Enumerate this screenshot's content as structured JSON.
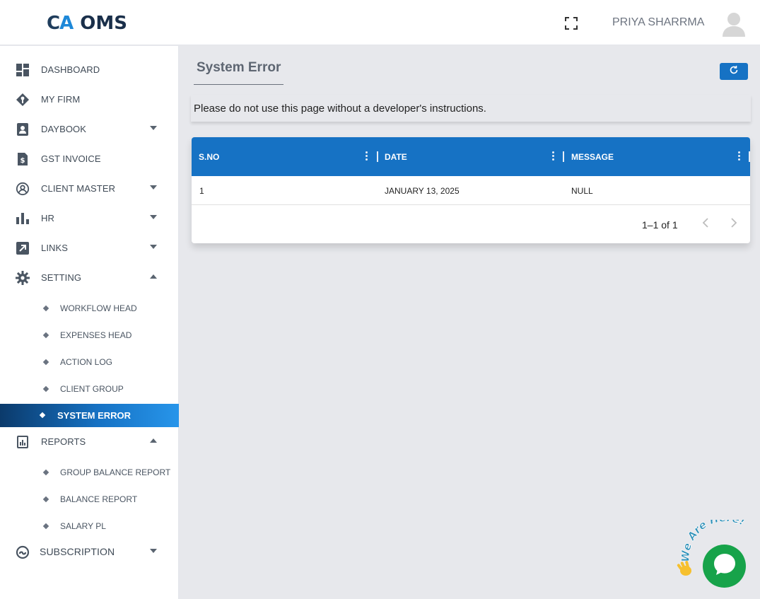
{
  "header": {
    "logo_ca_1": "C",
    "logo_ca_2": "A",
    "logo_text": "OMS",
    "user_name": "PRIYA SHARRMA",
    "icons": [
      "fullscreen-icon",
      "user-avatar-icon"
    ]
  },
  "sidebar": {
    "items": [
      {
        "label": "DASHBOARD",
        "icon": "dashboard-icon"
      },
      {
        "label": "MY FIRM",
        "icon": "firm-tag-icon"
      },
      {
        "label": "DAYBOOK",
        "icon": "contact-book-icon",
        "expandable": true,
        "expanded": false
      },
      {
        "label": "GST INVOICE",
        "icon": "invoice-icon"
      },
      {
        "label": "CLIENT MASTER",
        "icon": "client-circle-icon",
        "expandable": true,
        "expanded": false
      },
      {
        "label": "HR",
        "icon": "bar-chart-icon",
        "expandable": true,
        "expanded": false
      },
      {
        "label": "LINKS",
        "icon": "link-arrow-icon",
        "expandable": true,
        "expanded": false
      },
      {
        "label": "SETTING",
        "icon": "gear-icon",
        "expandable": true,
        "expanded": true
      },
      {
        "label": "REPORTS",
        "icon": "report-icon",
        "expandable": true,
        "expanded": true
      },
      {
        "label": "SUBSCRIPTION",
        "icon": "subscription-icon",
        "expandable": true,
        "expanded": false
      }
    ],
    "setting_sub": [
      "WORKFLOW HEAD",
      "EXPENSES HEAD",
      "ACTION LOG",
      "CLIENT GROUP",
      "SYSTEM ERROR"
    ],
    "reports_sub": [
      "GROUP BALANCE REPORT",
      "BALANCE REPORT",
      "SALARY PL"
    ],
    "active_item": "SYSTEM ERROR"
  },
  "main": {
    "title": "System Error",
    "notice": "Please do not use this page without a developer's instructions.",
    "table": {
      "columns": [
        "S.NO",
        "DATE",
        "MESSAGE"
      ],
      "rows": [
        {
          "sno": "1",
          "date": "JANUARY 13, 2025",
          "message": "NULL"
        }
      ],
      "pagination": "1–1 of 1"
    }
  },
  "chat_widget": {
    "text": "We Are Here!",
    "icon": "chat-bubble-icon"
  },
  "colors": {
    "primary": "#1672c4",
    "active_gradient_start": "#0b3a6b",
    "active_gradient_end": "#2795ea",
    "chat_green": "#17a34a",
    "background": "#e7e8ec"
  }
}
